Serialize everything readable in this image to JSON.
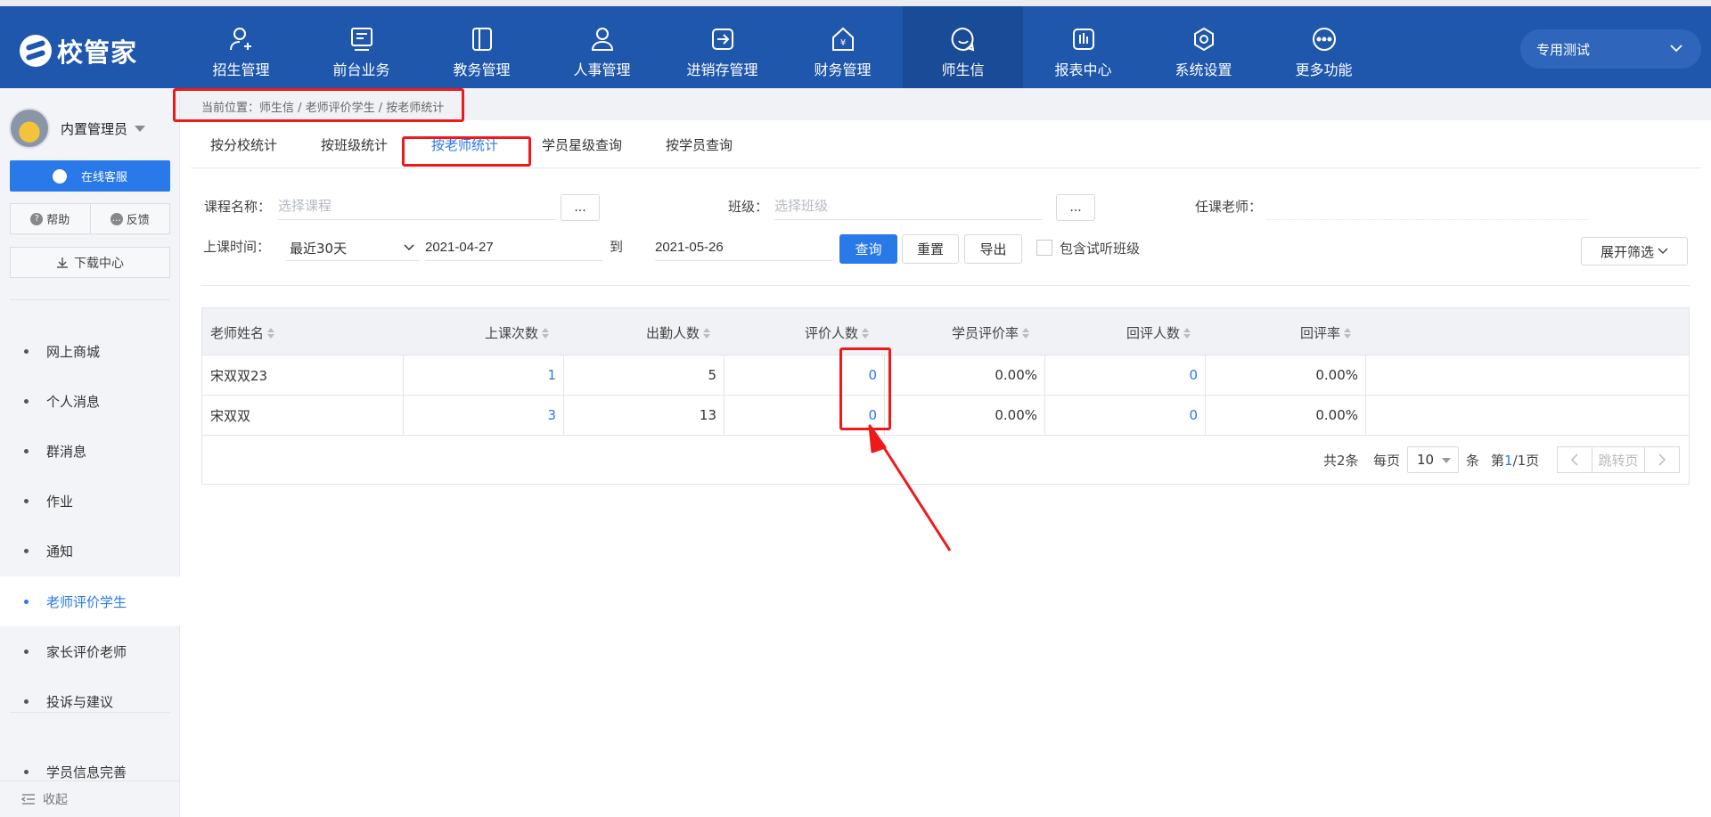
{
  "header": {
    "logo_text": "校管家",
    "nav": [
      {
        "label": "招生管理",
        "icon": "person-add-icon"
      },
      {
        "label": "前台业务",
        "icon": "desk-icon"
      },
      {
        "label": "教务管理",
        "icon": "book-icon"
      },
      {
        "label": "人事管理",
        "icon": "person-icon"
      },
      {
        "label": "进销存管理",
        "icon": "inventory-icon"
      },
      {
        "label": "财务管理",
        "icon": "finance-icon"
      },
      {
        "label": "师生信",
        "icon": "chat-icon",
        "active": true
      },
      {
        "label": "报表中心",
        "icon": "report-icon"
      },
      {
        "label": "系统设置",
        "icon": "settings-icon"
      },
      {
        "label": "更多功能",
        "icon": "more-icon"
      }
    ],
    "tenant": "专用测试"
  },
  "sidebar": {
    "user_name": "内置管理员",
    "online_service": "在线客服",
    "help": "帮助",
    "feedback": "反馈",
    "download_center": "下载中心",
    "menu": [
      "网上商城",
      "个人消息",
      "群消息",
      "作业",
      "通知",
      "老师评价学生",
      "家长评价老师",
      "投诉与建议"
    ],
    "active_menu": "老师评价学生",
    "extra_menu": "学员信息完善",
    "collapse": "收起"
  },
  "breadcrumb": "当前位置：师生信 / 老师评价学生 / 按老师统计",
  "tabs": [
    "按分校统计",
    "按班级统计",
    "按老师统计",
    "学员星级查询",
    "按学员查询"
  ],
  "active_tab": "按老师统计",
  "filters": {
    "course_label": "课程名称：",
    "course_placeholder": "选择课程",
    "class_label": "班级：",
    "class_placeholder": "选择班级",
    "teacher_label": "任课老师：",
    "dots": "...",
    "time_label": "上课时间：",
    "time_range": "最近30天",
    "start_date": "2021-04-27",
    "to": "到",
    "end_date": "2021-05-26",
    "query": "查询",
    "reset": "重置",
    "export": "导出",
    "include_trial": "包含试听班级",
    "expand": "展开筛选"
  },
  "table": {
    "columns": [
      "老师姓名",
      "上课次数",
      "出勤人数",
      "评价人数",
      "学员评价率",
      "回评人数",
      "回评率"
    ],
    "rows": [
      [
        "宋双双23",
        "1",
        "5",
        "0",
        "0.00%",
        "0",
        "0.00%"
      ],
      [
        "宋双双",
        "3",
        "13",
        "0",
        "0.00%",
        "0",
        "0.00%"
      ]
    ]
  },
  "pager": {
    "total": "共2条",
    "per_page_label": "每页",
    "per_page": "10",
    "unit": "条",
    "page_prefix": "第",
    "page_current": "1",
    "page_suffix": "/1页",
    "jump": "跳转页"
  },
  "colors": {
    "primary": "#2979e8",
    "header": "#1f57ad",
    "annotation": "#f0191a"
  }
}
